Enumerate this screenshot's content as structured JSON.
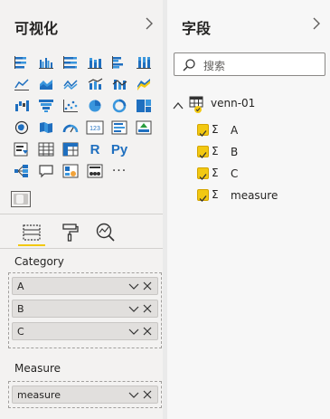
{
  "visualizations": {
    "title": "可视化",
    "rows": [
      [
        "stacked-bar-icon",
        "clustered-bar-icon",
        "stacked-bar-100-icon",
        "stacked-column-icon",
        "clustered-column-icon",
        "stacked-column-100-icon"
      ],
      [
        "line-chart-icon",
        "stacked-area-icon",
        "line-stacked-column-icon",
        "line-clustered-column-icon",
        "ribbon-chart-icon",
        "combo-line-icon"
      ],
      [
        "waterfall-icon",
        "funnel-icon",
        "scatter-icon",
        "pie-chart-icon",
        "donut-chart-icon",
        "treemap-icon"
      ],
      [
        "map-icon",
        "filled-map-icon",
        "gauge-icon",
        "card-icon",
        "multi-row-card-icon",
        "kpi-icon"
      ],
      [
        "slicer-icon",
        "table-icon",
        "matrix-icon",
        "r-visual-icon",
        "python-visual-icon"
      ],
      [
        "decomposition-tree-icon",
        "qa-icon",
        "key-influencers-icon",
        "paginated-report-icon",
        "more-visuals-icon"
      ]
    ],
    "r_label": "R",
    "py_label": "Py",
    "card_label": "123",
    "more_label": "···",
    "tabs": [
      "fields-tab",
      "format-tab",
      "analytics-tab"
    ],
    "wells": {
      "category_label": "Category",
      "category_items": [
        "A",
        "B",
        "C"
      ],
      "measure_label": "Measure",
      "measure_items": [
        "measure"
      ]
    }
  },
  "fields": {
    "title": "字段",
    "search_placeholder": "搜索",
    "table_name": "venn-01",
    "items": [
      "A",
      "B",
      "C",
      "measure"
    ],
    "sigma": "Σ"
  },
  "colors": {
    "accent": "#f2c811",
    "pane_bg": "#f3f2f1",
    "well_item_bg": "#e1dfdd",
    "icon_blue": "#1f6fbf"
  }
}
